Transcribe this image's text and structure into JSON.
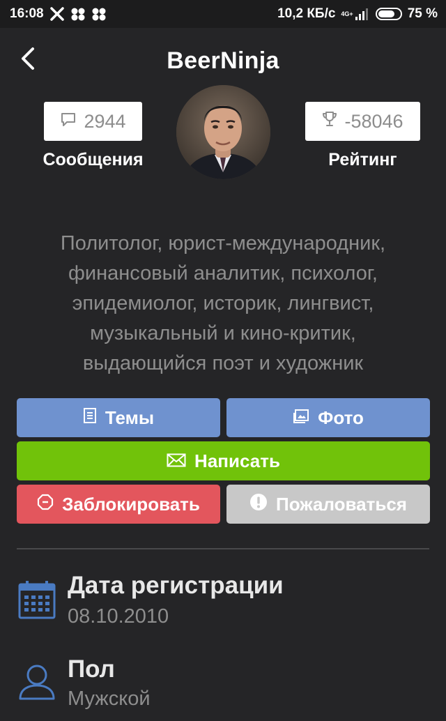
{
  "status_bar": {
    "time": "16:08",
    "network_speed": "10,2 КБ/с",
    "network_type": "4G+",
    "battery": "75 %",
    "battery_level": 0.75
  },
  "header": {
    "title": "BeerNinja"
  },
  "stats": {
    "messages_value": "2944",
    "messages_label": "Сообщения",
    "rating_value": "-58046",
    "rating_label": "Рейтинг"
  },
  "bio": {
    "line1": "Политолог, юрист-международник,",
    "line2": "финансовый аналитик, психолог,",
    "line3": "эпидемиолог, историк, лингвист,",
    "line4": "музыкальный и кино-критик,",
    "line5": "выдающийся поэт и художник"
  },
  "actions": {
    "topics_label": "Темы",
    "photo_label": "Фото",
    "write_label": "Написать",
    "block_label": "Заблокировать",
    "report_label": "Пожаловаться"
  },
  "info": {
    "registration_label": "Дата регистрации",
    "registration_value": "08.10.2010",
    "gender_label": "Пол",
    "gender_value": "Мужской"
  },
  "colors": {
    "background": "#252527",
    "blue_button": "#6f92cf",
    "green_button": "#71c20a",
    "red_button": "#e3565d",
    "grey_button": "#c8c8c8",
    "info_icon": "#4a7bc2"
  },
  "icons": {
    "back": "chevron-left-icon",
    "messages": "chat-bubble-icon",
    "rating": "trophy-icon",
    "topics": "document-icon",
    "photo": "image-icon",
    "write": "envelope-icon",
    "block": "block-octagon-icon",
    "report": "alert-circle-icon",
    "registration": "calendar-icon",
    "gender": "user-icon"
  }
}
